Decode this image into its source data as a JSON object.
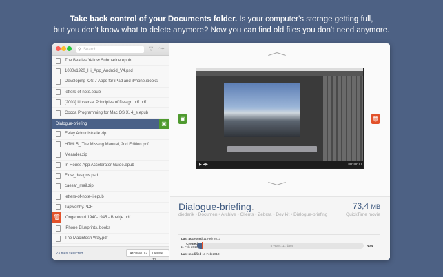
{
  "headline": {
    "bold": "Take back control of your Documents folder.",
    "rest1": " Is your computer's storage getting full,",
    "rest2": "but you don't know what to delete anymore? Now you can find old files you don't need anymore."
  },
  "sidebar": {
    "search_placeholder": "Search",
    "files": [
      {
        "name": "The Beatles Yellow Submarine.epub",
        "icon": "document-icon"
      },
      {
        "name": "1080x1920_Hi_App_Android_V4.psd",
        "icon": "image-icon"
      },
      {
        "name": "Developing iOS 7 Apps for iPad and iPhone.ibooks",
        "icon": "document-icon"
      },
      {
        "name": "letters-of-note.epub",
        "icon": "document-icon"
      },
      {
        "name": "[2003] Universal Principles of Design.pdf.pdf",
        "icon": "document-icon"
      },
      {
        "name": "Cocoa Programming for Mac OS X, 4_e.epub",
        "icon": "document-icon"
      },
      {
        "name": "Dialogue-briefing",
        "icon": "none",
        "state": "selected-archive"
      },
      {
        "name": "Eelay Administratie.zip",
        "icon": "folder-icon"
      },
      {
        "name": "HTML5_ The Missing Manual, 2nd Edition.pdf",
        "icon": "document-icon"
      },
      {
        "name": "Meander.zip",
        "icon": "folder-icon"
      },
      {
        "name": "In-House App Accelerator Guide.epub",
        "icon": "document-icon"
      },
      {
        "name": "Flow_designs.psd",
        "icon": "image-icon"
      },
      {
        "name": "caesar_mail.zip",
        "icon": "folder-icon"
      },
      {
        "name": "letters-of-note-ii.epub",
        "icon": "document-icon"
      },
      {
        "name": "Tapworthy.PDF",
        "icon": "document-icon"
      },
      {
        "name": "Ongehoord 1940-1945 - Boekje.pdf",
        "icon": "trash-icon",
        "state": "delete"
      },
      {
        "name": "iPhone Blueprints.ibooks",
        "icon": "document-icon"
      },
      {
        "name": "The Macintosh Way.pdf",
        "icon": "document-icon"
      }
    ],
    "selected_count": "23 files selected",
    "archive_label": "Archive 12",
    "delete_label": "Delete 11"
  },
  "preview": {
    "time": "00:00:00"
  },
  "info": {
    "title": "Dialogue-briefing",
    "title_dot": ".",
    "size_value": "73,4",
    "size_unit": "MB",
    "type": "QuickTime movie",
    "path": "diederik • Documen • Archive • Clients • Zebrsa • Dev kit • Dialogue-briefing",
    "last_accessed_label": "Last accessed",
    "last_accessed": "11 Feb 2013",
    "created_label": "Created",
    "created": "11 Feb 2013",
    "age": "5 years, 11 days",
    "now_label": "Now",
    "last_modified_label": "Last modified",
    "last_modified": "11 Feb 2013"
  },
  "colors": {
    "background": "#4d6184",
    "selection": "#4a6188",
    "archive": "#4f9a2f",
    "delete": "#e2512a"
  }
}
